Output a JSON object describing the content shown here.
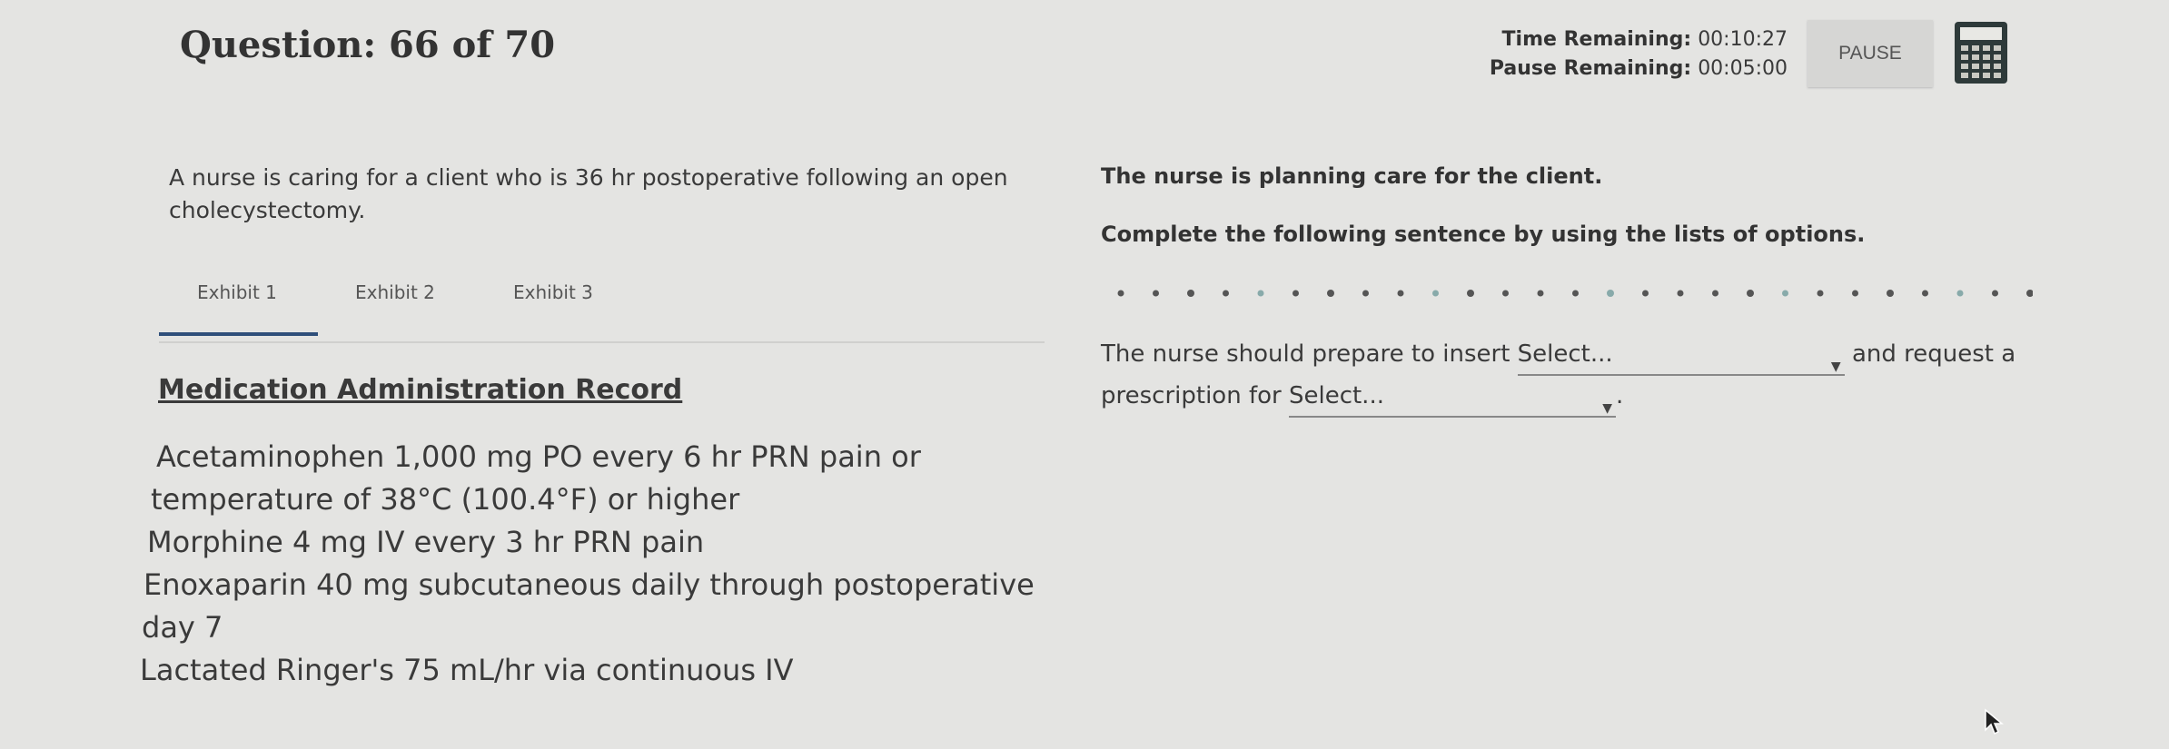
{
  "header": {
    "question_label": "Question: 66 of 70",
    "time_label": "Time Remaining:",
    "time_value": "00:10:27",
    "pause_label": "Pause Remaining:",
    "pause_value": "00:05:00",
    "pause_button": "PAUSE",
    "calculator_icon": "calculator-icon"
  },
  "left": {
    "scenario": "A nurse is caring for a client who is 36 hr postoperative following an open cholecystectomy.",
    "tabs": [
      "Exhibit 1",
      "Exhibit 2",
      "Exhibit 3"
    ],
    "active_tab": 0,
    "record_title": "Medication Administration Record",
    "medications": [
      "Acetaminophen 1,000 mg PO every 6 hr PRN pain or",
      "temperature of 38°C (100.4°F) or higher",
      "Morphine 4 mg IV every 3 hr PRN pain",
      "Enoxaparin 40 mg subcutaneous daily through postoperative",
      "day 7",
      "Lactated Ringer's 75 mL/hr via continuous IV"
    ]
  },
  "right": {
    "prompt": "The nurse is planning care for the client.",
    "instruction": "Complete the following sentence by using the lists of options.",
    "sentence_part1": "The nurse should prepare to insert",
    "select1": "Select...",
    "sentence_part2": "and request a prescription for",
    "select2": "Select...",
    "sentence_end": "."
  },
  "colors": {
    "background": "#e4e4e2",
    "tab_underline": "#2f4f7a",
    "calculator": "#2e3a3a"
  }
}
